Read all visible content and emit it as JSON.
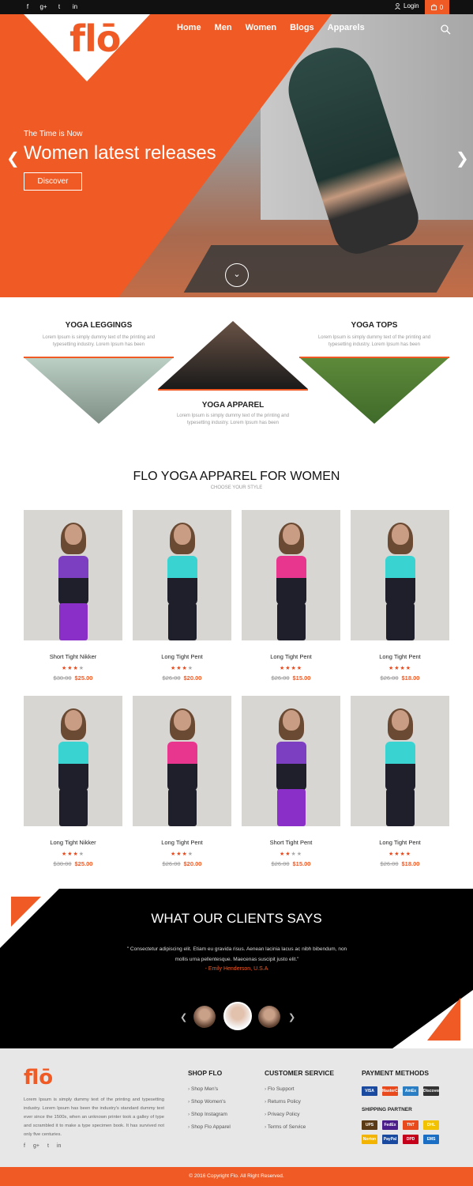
{
  "colors": {
    "accent": "#f05a24",
    "dark": "#000000",
    "footer_bg": "#e7e7e7"
  },
  "topbar": {
    "social": [
      {
        "icon": "facebook-icon",
        "glyph": "f"
      },
      {
        "icon": "google-plus-icon",
        "glyph": "g+"
      },
      {
        "icon": "twitter-icon",
        "glyph": "t"
      },
      {
        "icon": "linkedin-icon",
        "glyph": "in"
      }
    ],
    "login_label": "Login",
    "cart_count": "0"
  },
  "header": {
    "logo": "flō",
    "nav": [
      "Home",
      "Men",
      "Women",
      "Blogs",
      "Apparels"
    ]
  },
  "hero": {
    "subtitle": "The Time is Now",
    "title": "Women latest releases",
    "button": "Discover"
  },
  "categories": [
    {
      "title": "YOGA LEGGINGS",
      "desc": "Lorem Ipsum is simply dummy text of the printing and typesetting industry. Lorem Ipsum has been"
    },
    {
      "title": "YOGA APPAREL",
      "desc": "Lorem Ipsum is simply dummy text of the printing and typesetting industry. Lorem Ipsum has been"
    },
    {
      "title": "YOGA TOPS",
      "desc": "Lorem Ipsum is simply dummy text of the printing and typesetting industry. Lorem Ipsum has been"
    }
  ],
  "products_section": {
    "title": "FLO YOGA APPAREL FOR WOMEN",
    "subtitle": "CHOOSE YOUR STYLE"
  },
  "products": [
    {
      "name": "Short Tight Nikker",
      "rating": 3,
      "old_price": "$30.00",
      "price": "$25.00",
      "top": "#7d3fc1",
      "legs": "#8a2fc7"
    },
    {
      "name": "Long Tight Pent",
      "rating": 3,
      "old_price": "$26.00",
      "price": "$20.00",
      "top": "#39d3d1",
      "legs": "#1e1f2a"
    },
    {
      "name": "Long Tight Pent",
      "rating": 4,
      "old_price": "$26.00",
      "price": "$15.00",
      "top": "#e8368f",
      "legs": "#1e1f2a"
    },
    {
      "name": "Long Tight Pent",
      "rating": 4,
      "old_price": "$26.00",
      "price": "$18.00",
      "top": "#39d3d1",
      "legs": "#1e1f2a"
    },
    {
      "name": "Long Tight Nikker",
      "rating": 3,
      "old_price": "$30.00",
      "price": "$25.00",
      "top": "#39d3d1",
      "legs": "#1e1f2a"
    },
    {
      "name": "Long Tight Pent",
      "rating": 3,
      "old_price": "$26.00",
      "price": "$20.00",
      "top": "#e8368f",
      "legs": "#1e1f2a"
    },
    {
      "name": "Short Tight Pent",
      "rating": 2,
      "old_price": "$26.00",
      "price": "$15.00",
      "top": "#7d3fc1",
      "legs": "#8a2fc7"
    },
    {
      "name": "Long Tight Pent",
      "rating": 4,
      "old_price": "$26.00",
      "price": "$18.00",
      "top": "#39d3d1",
      "legs": "#1e1f2a"
    }
  ],
  "testimonial": {
    "title": "WHAT OUR CLIENTS SAYS",
    "quote": "\" Consectetur adipiscing elit. Etiam eu gravida risus. Aenean lacinia lacus ac nibh bibendum, non mollis urna pellentesque. Maecenas suscipit justo elit.\"",
    "author": "- Emily Henderson, U.S.A"
  },
  "footer": {
    "logo": "flō",
    "about": "Lorem Ipsum is simply dummy text of the printing and typesetting industry. Lorem Ipsum has been the industry's standard dummy text ever since the 1500s, when an unknown printer took a galley of type and scrambled it to make a type specimen book. It has survived not only five centuries.",
    "shop": {
      "title": "SHOP FLO",
      "items": [
        "Shop Men's",
        "Shop Women's",
        "Shop Instagram",
        "Shop Flo Apparel"
      ]
    },
    "service": {
      "title": "CUSTOMER SERVICE",
      "items": [
        "Flo Support",
        "Returns Policy",
        "Privacy Policy",
        "Terms of Service"
      ]
    },
    "payment": {
      "title": "PAYMENT METHODS",
      "shipping_title": "SHIPPING PARTNER",
      "methods": [
        {
          "label": "VISA",
          "color": "#1a4aa0"
        },
        {
          "label": "MasterCard",
          "color": "#e8491d"
        },
        {
          "label": "AmEx",
          "color": "#2a7fc4"
        },
        {
          "label": "Discover",
          "color": "#333333"
        }
      ],
      "partners": [
        {
          "label": "UPS",
          "color": "#5a3b16"
        },
        {
          "label": "FedEx",
          "color": "#4b1d8a"
        },
        {
          "label": "TNT",
          "color": "#e8491d"
        },
        {
          "label": "DHL",
          "color": "#f2c200"
        },
        {
          "label": "Norton",
          "color": "#f2b400"
        },
        {
          "label": "PayPal",
          "color": "#1a4aa0"
        },
        {
          "label": "DPD",
          "color": "#c4001a"
        },
        {
          "label": "EMS",
          "color": "#1a6fc4"
        }
      ]
    },
    "copyright": "© 2016 Copyright Flo. All Right Reserved."
  }
}
